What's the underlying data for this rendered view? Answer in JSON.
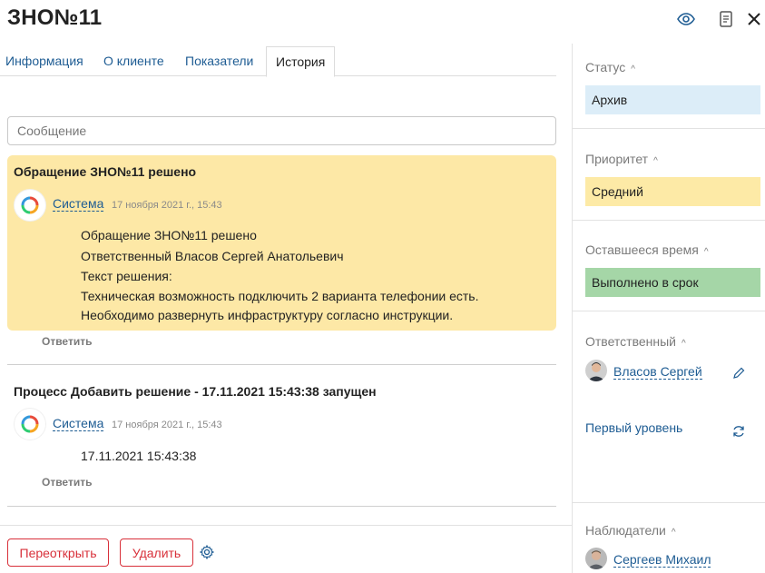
{
  "header": {
    "title": "ЗНО№11"
  },
  "tabs": [
    {
      "label": "Информация"
    },
    {
      "label": "О клиенте"
    },
    {
      "label": "Показатели"
    },
    {
      "label": "История"
    }
  ],
  "message_input": {
    "placeholder": "Сообщение",
    "value": ""
  },
  "history": [
    {
      "title": "Обращение ЗНО№11 решено",
      "author": "Система",
      "date": "17 ноября 2021 г., 15:43",
      "lines": [
        "Обращение ЗНО№11 решено",
        "Ответственный Власов Сергей Анатольевич",
        "Текст решения:",
        "Техническая возможность подключить 2 варианта телефонии есть.",
        "Необходимо развернуть инфраструктуру согласно инструкции."
      ],
      "reply_label": "Ответить"
    },
    {
      "title": "Процесс Добавить решение - 17.11.2021 15:43:38 запущен",
      "author": "Система",
      "date": "17 ноября 2021 г., 15:43",
      "lines": [
        "17.11.2021 15:43:38"
      ],
      "reply_label": "Ответить"
    }
  ],
  "footer": {
    "reopen_label": "Переоткрыть",
    "delete_label": "Удалить"
  },
  "sidebar": {
    "status": {
      "label": "Статус",
      "value": "Архив",
      "color": "#dcedf8"
    },
    "priority": {
      "label": "Приоритет",
      "value": "Средний",
      "color": "#fdeaa6"
    },
    "remaining": {
      "label": "Оставшееся время",
      "value": "Выполнено в срок",
      "color": "#a5d6a7"
    },
    "responsible": {
      "label": "Ответственный",
      "person": "Власов Сергей",
      "group": "Первый уровень"
    },
    "watchers": {
      "label": "Наблюдатели",
      "person": "Сергеев Михаил"
    }
  },
  "icons": {
    "view": "eye-icon",
    "document": "document-icon",
    "close": "close-icon",
    "settings": "gear-icon",
    "edit": "pencil-icon",
    "refresh": "refresh-icon"
  }
}
